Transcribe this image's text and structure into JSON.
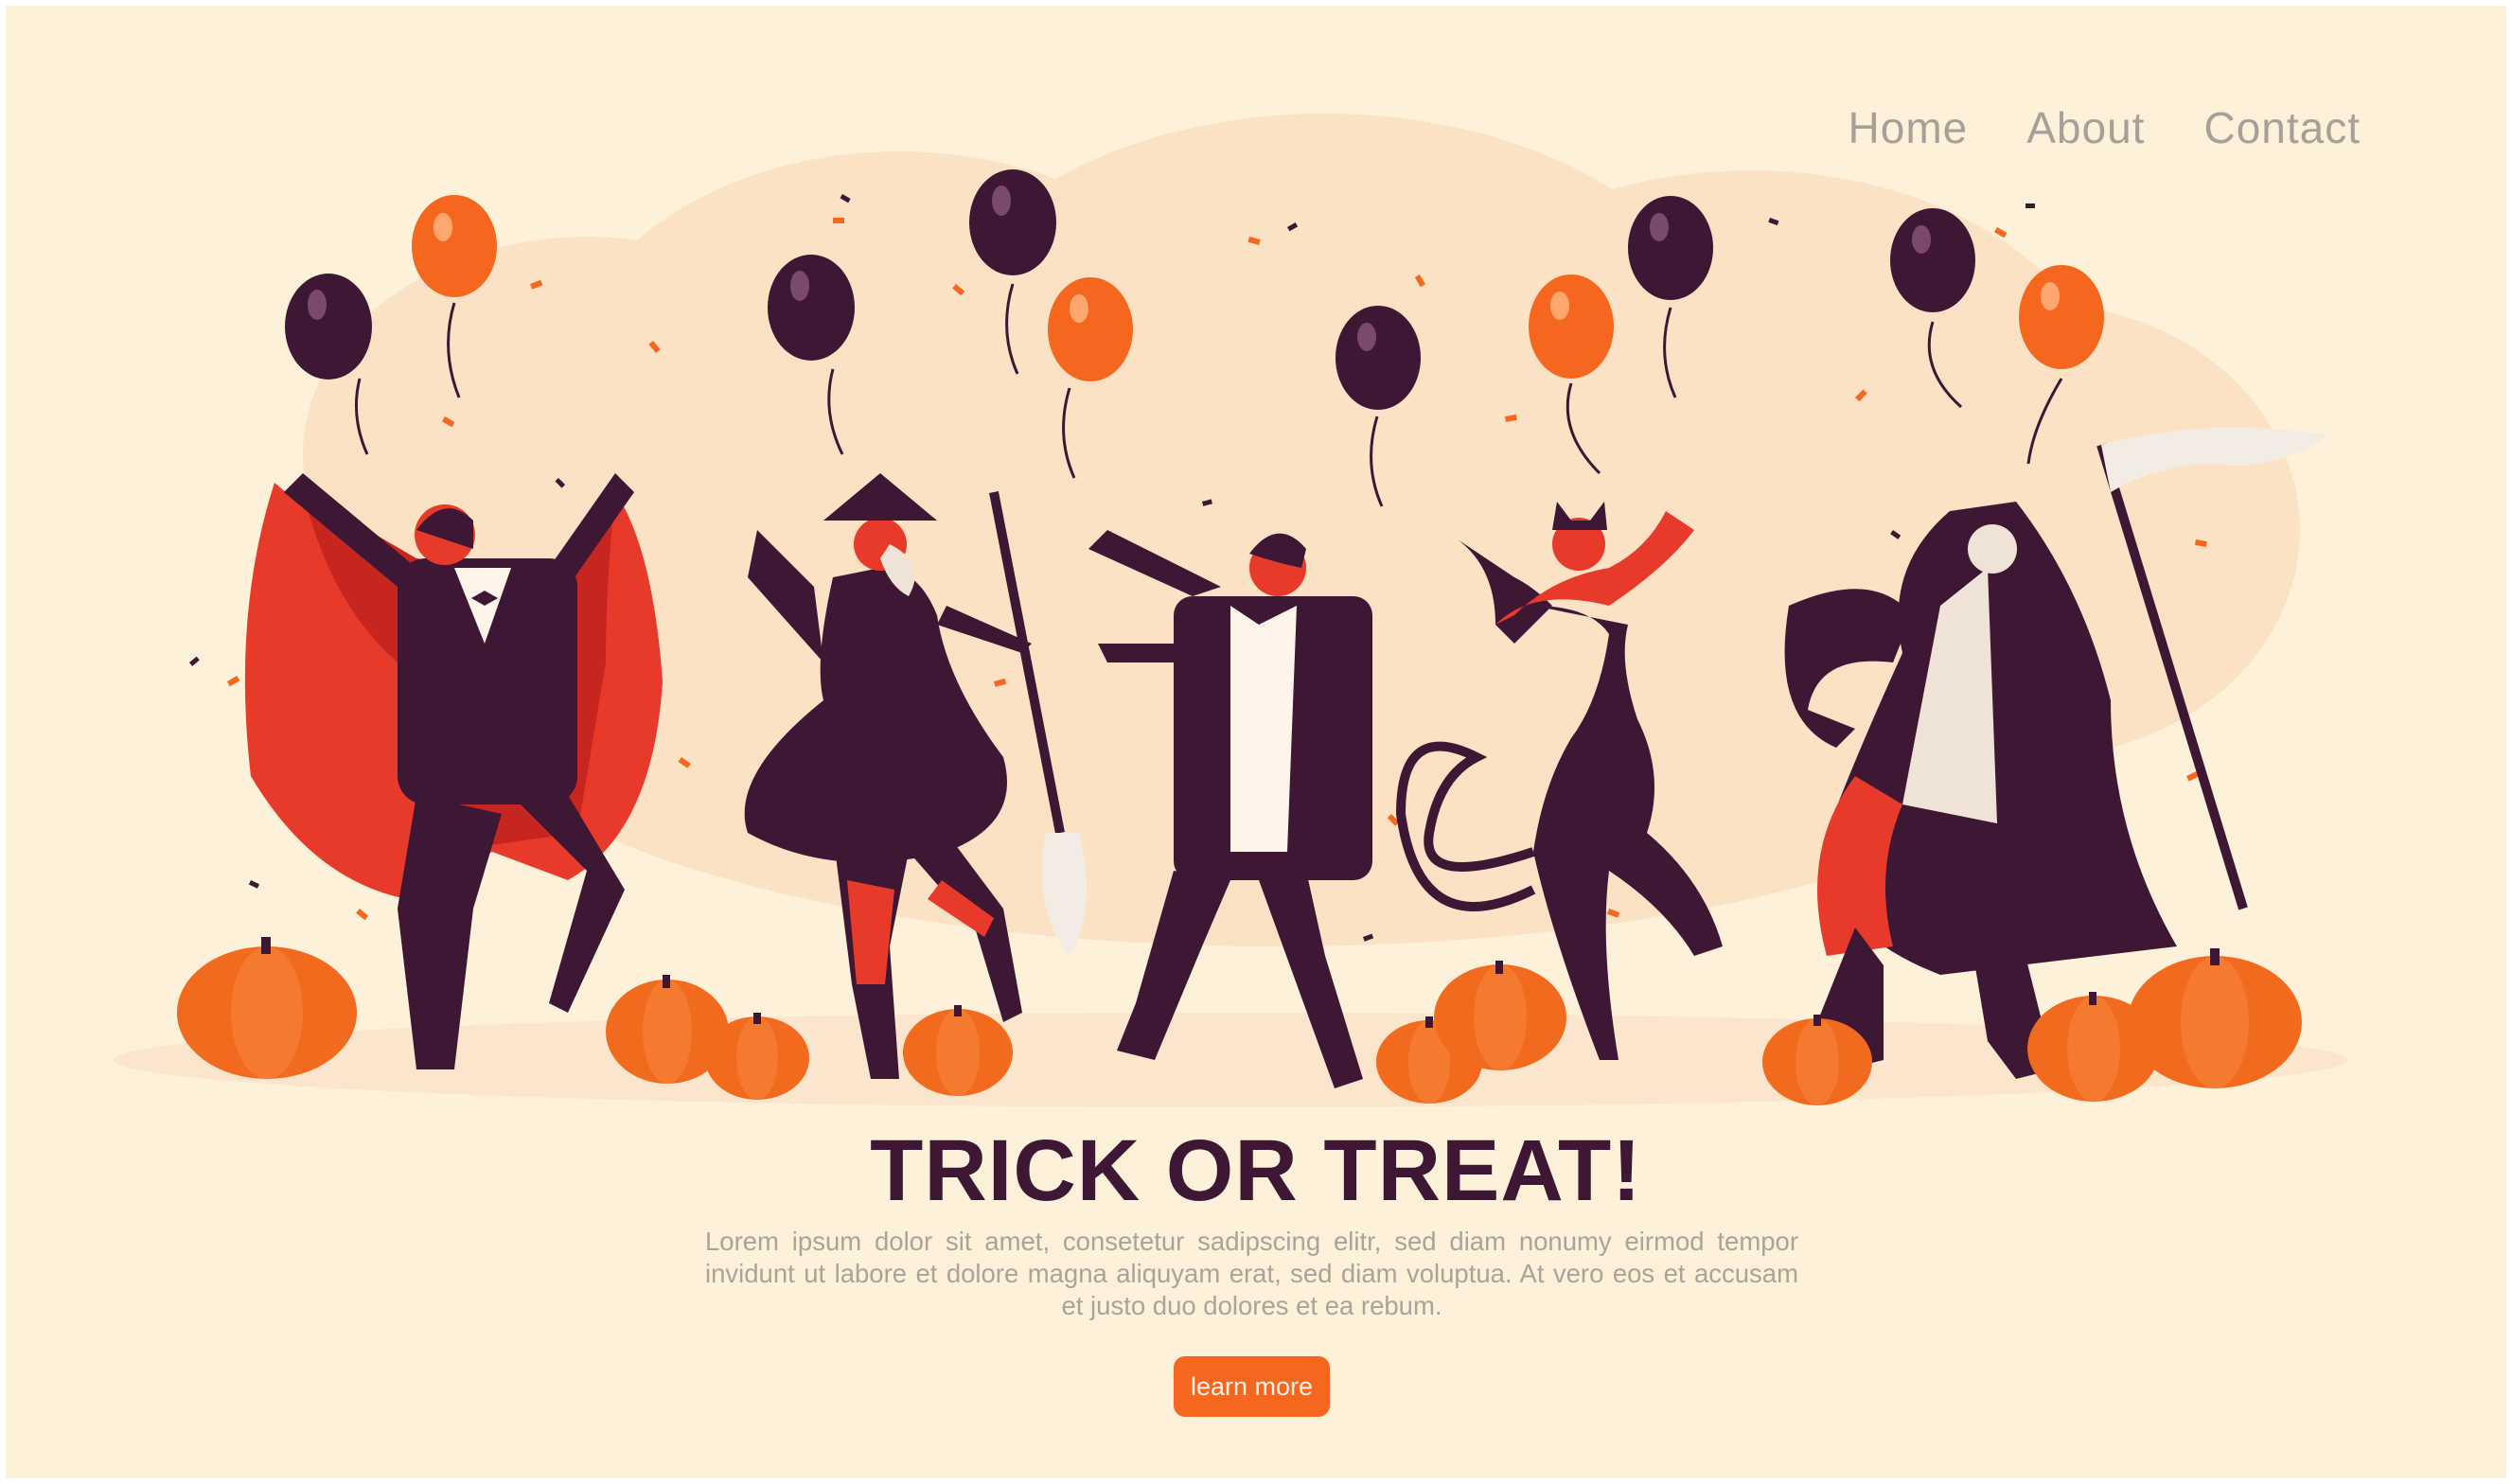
{
  "nav": {
    "items": [
      {
        "label": "Home"
      },
      {
        "label": "About"
      },
      {
        "label": "Contact"
      }
    ]
  },
  "hero": {
    "headline": "TRICK OR TREAT!",
    "body": "Lorem ipsum dolor sit amet, consetetur sadipscing elitr, sed diam nonumy eirmod tempor invidunt ut labore et dolore magna aliquyam erat, sed diam voluptua. At vero eos et accusam et justo duo dolores et ea rebum.",
    "cta_label": "learn more"
  },
  "illustration": {
    "characters": [
      "vampire",
      "witch",
      "zombie",
      "cat-woman",
      "grim-reaper"
    ],
    "colors": {
      "background": "#fdf1da",
      "cloud": "#fbe2c5",
      "dark": "#3d1733",
      "orange": "#f5671e",
      "red": "#e83a2b",
      "pumpkin": "#f26a1e"
    }
  }
}
